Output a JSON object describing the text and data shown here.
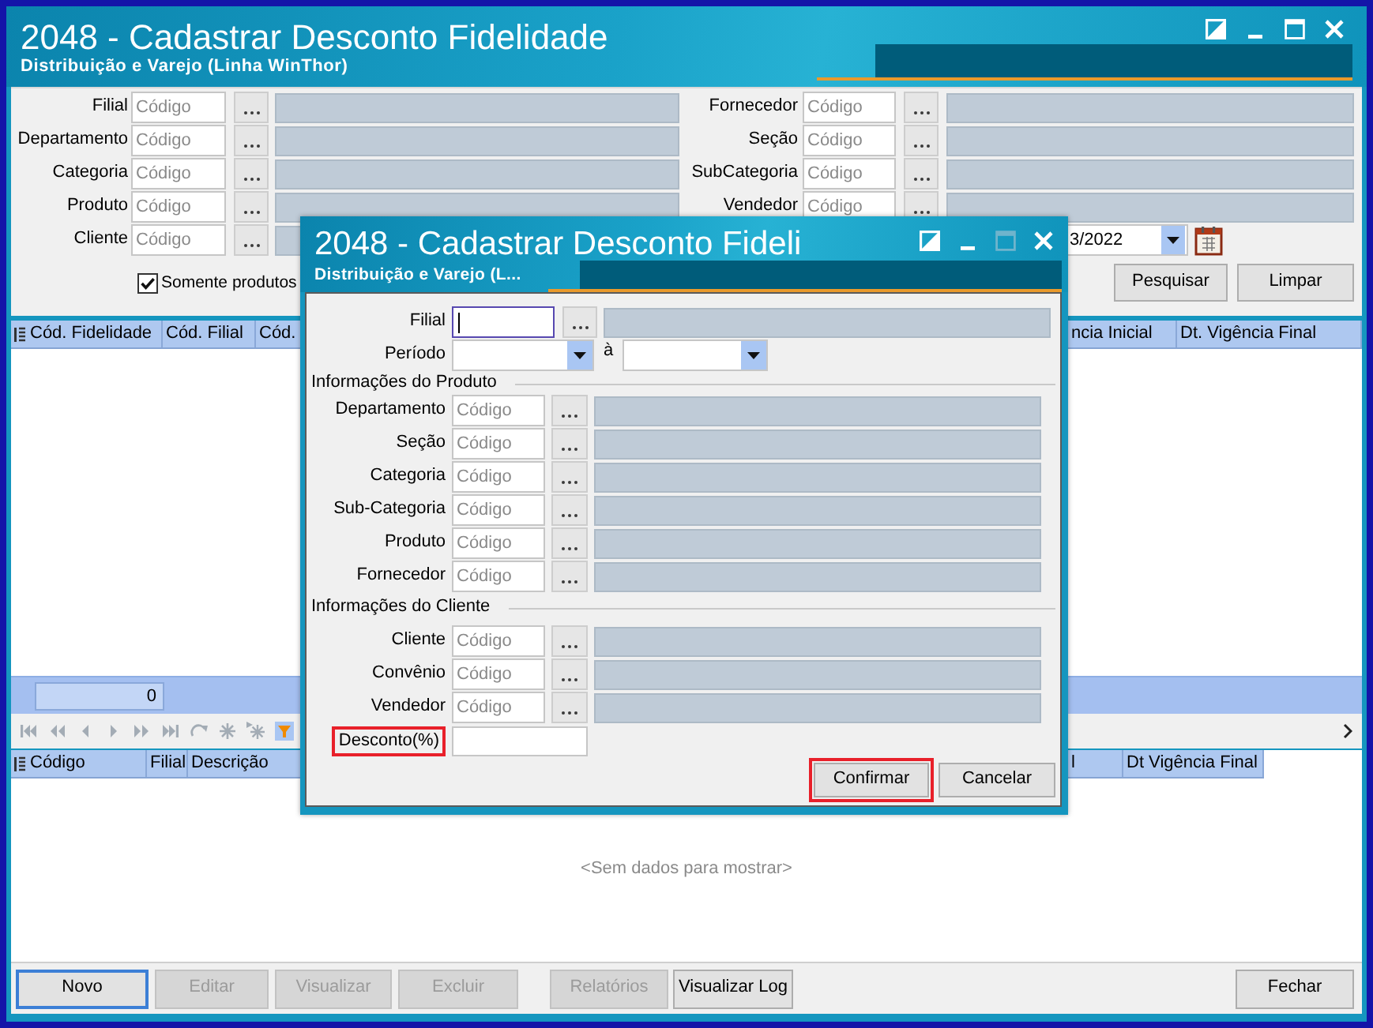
{
  "window": {
    "title": "2048 - Cadastrar Desconto Fidelidade",
    "subtitle": "Distribuição e Varejo (Linha WinThor)",
    "controls": [
      {
        "kind": "half_square",
        "disabled": false
      },
      {
        "kind": "minimize",
        "disabled": false
      },
      {
        "kind": "maximize",
        "disabled": false
      },
      {
        "kind": "close",
        "disabled": false
      }
    ]
  },
  "filters": {
    "left": [
      {
        "label": "Filial",
        "placeholder": "Código"
      },
      {
        "label": "Departamento",
        "placeholder": "Código"
      },
      {
        "label": "Categoria",
        "placeholder": "Código"
      },
      {
        "label": "Produto",
        "placeholder": "Código"
      },
      {
        "label": "Cliente",
        "placeholder": "Código"
      }
    ],
    "right": [
      {
        "label": "Fornecedor",
        "placeholder": "Código"
      },
      {
        "label": "Seção",
        "placeholder": "Código"
      },
      {
        "label": "SubCategoria",
        "placeholder": "Código"
      },
      {
        "label": "Vendedor",
        "placeholder": "Código"
      }
    ],
    "date": {
      "value": "3/2022"
    },
    "checkbox": {
      "label": "Somente produtos",
      "checked": true
    },
    "buttons": [
      {
        "label": "Pesquisar"
      },
      {
        "label": "Limpar"
      }
    ]
  },
  "top_grid": {
    "columns_left": [
      "Cód. Fidelidade",
      "Cód. Filial",
      "Cód."
    ],
    "columns_right": [
      "ncia Inicial",
      "Dt. Vigência Final"
    ],
    "count": "0"
  },
  "navigator": [
    {
      "kind": "first",
      "disabled": true
    },
    {
      "kind": "prior_page",
      "disabled": true
    },
    {
      "kind": "prior",
      "disabled": true
    },
    {
      "kind": "next",
      "disabled": true
    },
    {
      "kind": "next_page",
      "disabled": true
    },
    {
      "kind": "last",
      "disabled": true
    },
    {
      "kind": "refresh",
      "disabled": true
    },
    {
      "kind": "insert",
      "disabled": true
    },
    {
      "kind": "append",
      "disabled": true
    },
    {
      "kind": "filter",
      "disabled": false
    }
  ],
  "bottom_grid": {
    "columns_left": [
      "Código",
      "Filial",
      "Descrição"
    ],
    "columns_right": [
      "l",
      "Dt Vigência Final"
    ],
    "empty_message": "<Sem dados para mostrar>"
  },
  "toolbar": {
    "groups": [
      [
        {
          "label": "Novo",
          "disabled": false,
          "focused": true
        },
        {
          "label": "Editar",
          "disabled": true,
          "focused": false
        },
        {
          "label": "Visualizar",
          "disabled": true,
          "focused": false
        },
        {
          "label": "Excluir",
          "disabled": true,
          "focused": false
        }
      ],
      [
        {
          "label": "Relatórios",
          "disabled": true,
          "focused": false
        },
        {
          "label": "Visualizar Log",
          "disabled": false,
          "focused": false
        }
      ]
    ],
    "right": [
      {
        "label": "Fechar",
        "disabled": false,
        "focused": false
      }
    ]
  },
  "dialog": {
    "title": "2048 - Cadastrar Desconto Fideli",
    "subtitle": "Distribuição e Varejo (L...",
    "controls": [
      {
        "kind": "half_square",
        "disabled": false
      },
      {
        "kind": "minimize",
        "disabled": false
      },
      {
        "kind": "maximize",
        "disabled": true
      },
      {
        "kind": "close",
        "disabled": false
      }
    ],
    "branch": {
      "label": "Filial",
      "focused": true
    },
    "period": {
      "label": "Período",
      "separator": "à"
    },
    "sections": [
      {
        "title": "Informações do Produto",
        "fields": [
          {
            "label": "Departamento",
            "placeholder": "Código"
          },
          {
            "label": "Seção",
            "placeholder": "Código"
          },
          {
            "label": "Categoria",
            "placeholder": "Código"
          },
          {
            "label": "Sub-Categoria",
            "placeholder": "Código"
          },
          {
            "label": "Produto",
            "placeholder": "Código"
          },
          {
            "label": "Fornecedor",
            "placeholder": "Código"
          }
        ]
      },
      {
        "title": "Informações do Cliente",
        "fields": [
          {
            "label": "Cliente",
            "placeholder": "Código"
          },
          {
            "label": "Convênio",
            "placeholder": "Código"
          },
          {
            "label": "Vendedor",
            "placeholder": "Código"
          }
        ]
      }
    ],
    "discount": {
      "label": "Desconto(%)",
      "highlighted": true
    },
    "buttons": [
      {
        "label": "Confirmar",
        "highlighted": true
      },
      {
        "label": "Cancelar",
        "highlighted": false
      }
    ]
  }
}
